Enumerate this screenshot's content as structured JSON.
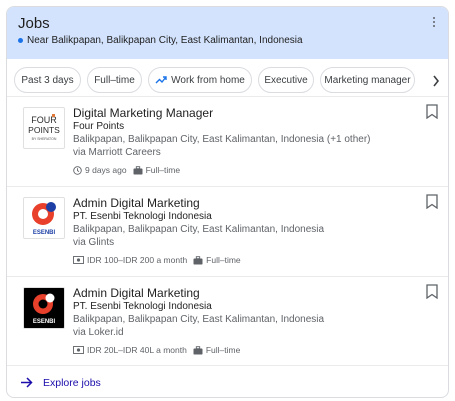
{
  "header": {
    "title": "Jobs",
    "location": "Near Balikpapan, Balikpapan City, East Kalimantan, Indonesia"
  },
  "chips": [
    {
      "label": "Past 3 days",
      "icon": ""
    },
    {
      "label": "Full–time",
      "icon": ""
    },
    {
      "label": "Work from home",
      "icon": "trending-icon"
    },
    {
      "label": "Executive",
      "icon": ""
    },
    {
      "label": "Marketing manager",
      "icon": ""
    }
  ],
  "jobs": [
    {
      "title": "Digital Marketing Manager",
      "company": "Four Points",
      "location": "Balikpapan, Balikpapan City, East Kalimantan, Indonesia (+1 other)",
      "via": "via Marriott Careers",
      "posted": "9 days ago",
      "salary": "",
      "type": "Full–time",
      "logo": {
        "line1": "FOUR",
        "line2": "POINTS",
        "line3": "BY SHERATON"
      }
    },
    {
      "title": "Admin Digital Marketing",
      "company": "PT. Esenbi Teknologi Indonesia",
      "location": "Balikpapan, Balikpapan City, East Kalimantan, Indonesia",
      "via": "via Glints",
      "posted": "",
      "salary": "IDR 100–IDR 200 a month",
      "type": "Full–time",
      "logo": {
        "line1": "ESENBI"
      }
    },
    {
      "title": "Admin Digital Marketing",
      "company": "PT. Esenbi Teknologi Indonesia",
      "location": "Balikpapan, Balikpapan City, East Kalimantan, Indonesia",
      "via": "via Loker.id",
      "posted": "",
      "salary": "IDR 20L–IDR 40L a month",
      "type": "Full–time",
      "logo": {
        "line1": "ESENBI"
      }
    }
  ],
  "explore": {
    "label": "Explore jobs"
  },
  "colors": {
    "header_bg": "#d3e3fd",
    "accent": "#1a73e8",
    "link": "#1a0dab",
    "esenbi_red": "#e8402a",
    "esenbi_blue": "#1d3fa5"
  }
}
